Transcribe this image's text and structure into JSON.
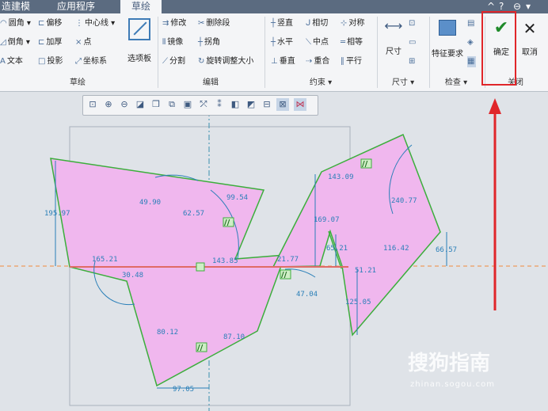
{
  "tabs": [
    "造建模",
    "应用程序",
    "草绘"
  ],
  "window_controls": [
    "^",
    "?",
    "⊖",
    "▾"
  ],
  "ribbon": {
    "col1": [
      "圆角 ▾",
      "倒角 ▾",
      "文本"
    ],
    "col2": [
      "偏移",
      "加厚",
      "投影"
    ],
    "col3": [
      "中心线 ▾",
      "点",
      "坐标系"
    ],
    "options_board": "选项板",
    "group_sketch": "草绘",
    "edit": [
      "修改",
      "删除段",
      "镜像",
      "拐角",
      "分割",
      "旋转调整大小"
    ],
    "group_edit": "编辑",
    "constraints": [
      "竖直",
      "相切",
      "对称",
      "水平",
      "中点",
      "相等",
      "垂直",
      "重合",
      "平行"
    ],
    "group_constraint": "约束 ▾",
    "dimension": "尺寸",
    "group_dimension": "尺寸 ▾",
    "feature_req": "特征要求",
    "group_inspect": "检查 ▾",
    "ok": "确定",
    "cancel": "取消",
    "group_close": "关闭"
  },
  "dimensions": [
    "195.97",
    "49.90",
    "99.54",
    "62.57",
    "165.21",
    "30.48",
    "143.85",
    "21.77",
    "80.12",
    "87.10",
    "97.05",
    "47.04",
    "143.09",
    "169.07",
    "65.21",
    "51.21",
    "125.05",
    "240.77",
    "116.42",
    "66.57"
  ],
  "watermark": "搜狗指南",
  "watermark_url": "zhinan.sogou.com",
  "colors": {
    "fill": "#f0b7ee",
    "edge": "#3cae3c",
    "dim": "#2a7fb8",
    "highlight": "#e0262a"
  }
}
